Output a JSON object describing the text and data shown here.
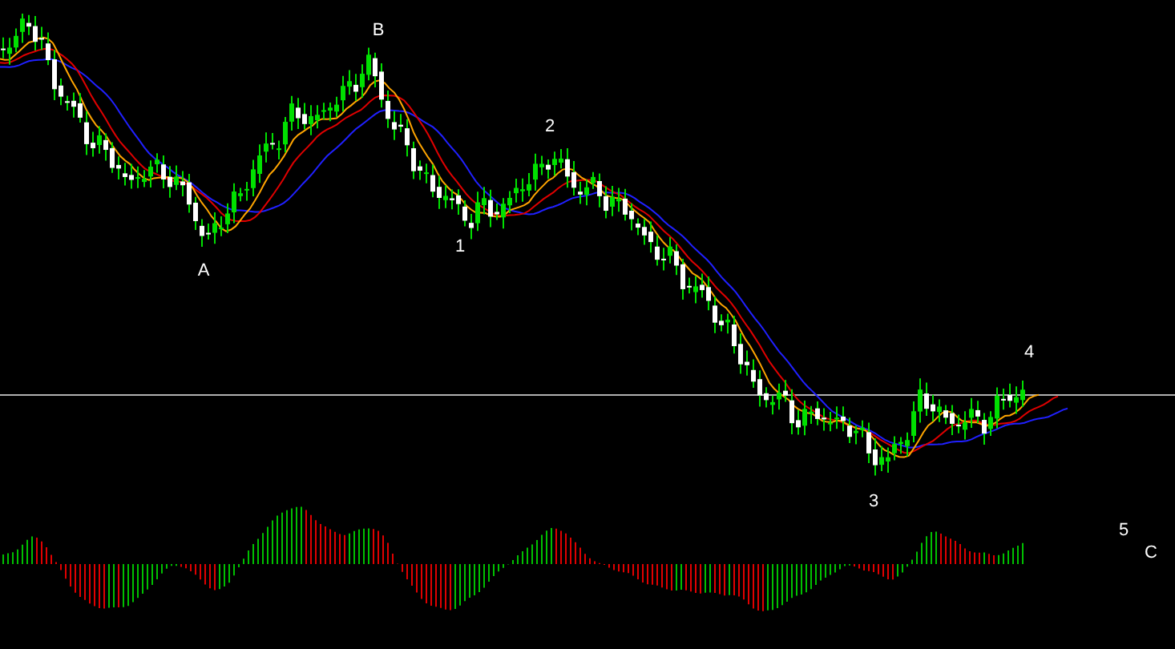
{
  "chart": {
    "wave_labels": [
      {
        "text": "B"
      },
      {
        "text": "2"
      },
      {
        "text": "A"
      },
      {
        "text": "1"
      },
      {
        "text": "4"
      },
      {
        "text": "3"
      },
      {
        "text": "5"
      },
      {
        "text": "C"
      }
    ]
  }
}
